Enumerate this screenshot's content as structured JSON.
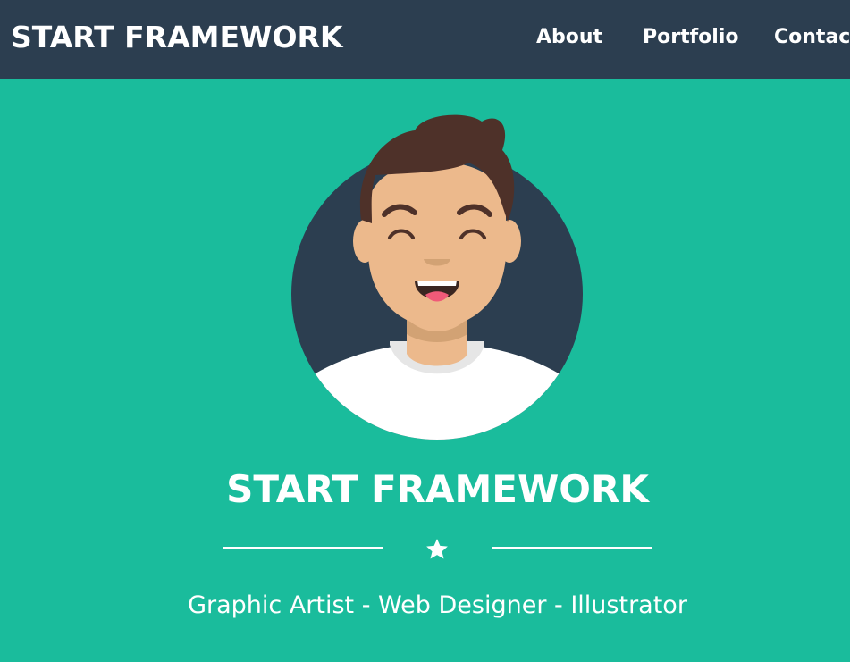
{
  "navbar": {
    "brand": "START FRAMEWORK",
    "links": [
      "About",
      "Portfolio",
      "Contact"
    ]
  },
  "hero": {
    "title": "START FRAMEWORK",
    "divider_icon": "star-icon",
    "tagline": "Graphic Artist - Web Designer - Illustrator",
    "avatar_icon": "avatar-illustration"
  },
  "colors": {
    "navbar_bg": "#2c3e50",
    "page_bg": "#1abc9c",
    "text": "#ffffff",
    "avatar_circle": "#2c3e50",
    "skin": "#ecb98c",
    "hair": "#4e3129",
    "shirt": "#ffffff"
  }
}
